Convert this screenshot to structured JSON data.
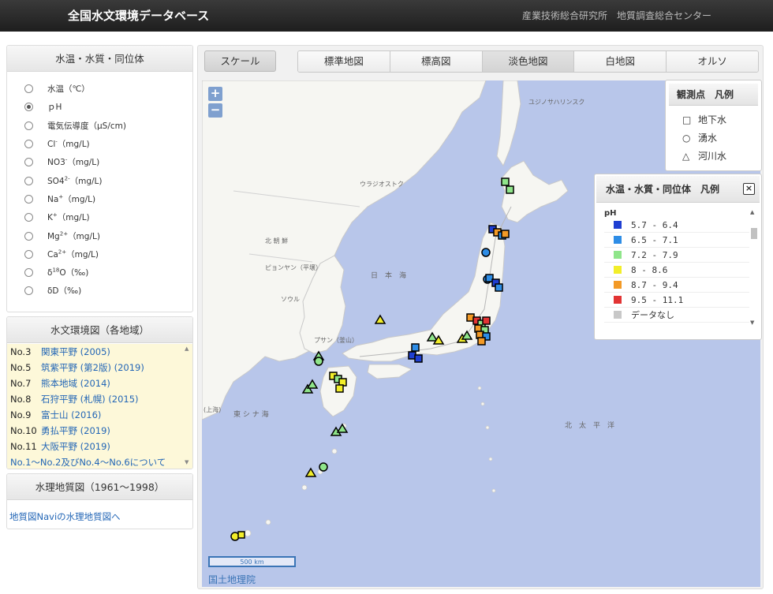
{
  "header": {
    "title": "全国水文環境データベース",
    "org": "産業技術総合研究所　地質調査総合センター"
  },
  "parameters_panel": {
    "title": "水温・水質・同位体",
    "options": [
      {
        "label": "水温（℃）",
        "selected": false
      },
      {
        "label": "ｐH",
        "selected": true
      },
      {
        "label": "電気伝導度（μS/cm)",
        "selected": false
      },
      {
        "label": "Cl",
        "sup": "-",
        "suffix": "（mg/L)",
        "selected": false
      },
      {
        "label": "NO3",
        "sup": "-",
        "suffix": "（mg/L)",
        "selected": false
      },
      {
        "label": "SO4",
        "sup": "2-",
        "suffix": "（mg/L)",
        "selected": false
      },
      {
        "label": "Na",
        "sup": "+",
        "suffix": "（mg/L)",
        "selected": false
      },
      {
        "label": "K",
        "sup": "+",
        "suffix": "（mg/L)",
        "selected": false
      },
      {
        "label": "Mg",
        "sup": "2+",
        "suffix": "（mg/L)",
        "selected": false
      },
      {
        "label": "Ca",
        "sup": "2+",
        "suffix": "（mg/L)",
        "selected": false
      },
      {
        "label": "δ",
        "sup": "18",
        "suffix": "O（‰)",
        "selected": false
      },
      {
        "label": "δD（‰)",
        "selected": false
      }
    ]
  },
  "regions_panel": {
    "title": "水文環境図（各地域）",
    "items": [
      {
        "no": "No.3",
        "name": "関東平野 (2005)"
      },
      {
        "no": "No.5",
        "name": "筑紫平野 (第2版) (2019)"
      },
      {
        "no": "No.7",
        "name": "熊本地域 (2014)"
      },
      {
        "no": "No.8",
        "name": "石狩平野 (札幌) (2015)"
      },
      {
        "no": "No.9",
        "name": "富士山 (2016)"
      },
      {
        "no": "No.10",
        "name": "勇払平野 (2019)"
      },
      {
        "no": "No.11",
        "name": "大阪平野 (2019)"
      }
    ],
    "note": "No.1～No.2及びNo.4～No.6について"
  },
  "hydro_panel": {
    "title": "水理地質図（1961～1998）",
    "link": "地質図Naviの水理地質図へ"
  },
  "toolbar": {
    "scale_label": "スケール",
    "tabs": [
      {
        "label": "標準地図",
        "active": false
      },
      {
        "label": "標高図",
        "active": false
      },
      {
        "label": "淡色地図",
        "active": true
      },
      {
        "label": "白地図",
        "active": false
      },
      {
        "label": "オルソ",
        "active": false
      }
    ]
  },
  "map": {
    "zoom_in": "+",
    "zoom_out": "−",
    "scale_text": "500 km",
    "credit": "国土地理院",
    "labels": {
      "sakhalin": "ユジノサハリンスク",
      "vladivostok": "ウラジオストク",
      "kita": "北 朝 鮮",
      "pyongyang": "ピョンヤン（平壌）",
      "nihonkai": "日　本　海",
      "seoul": "ソウル",
      "busan": "プサン（釜山）",
      "higashi": "東 シ ナ 海",
      "taiheiyo": "北　太　平　洋",
      "kaijou": "(上海)"
    }
  },
  "legend_points": {
    "title": "観測点　凡例",
    "items": [
      {
        "symbol": "□",
        "label": "地下水"
      },
      {
        "symbol": "○",
        "label": "湧水"
      },
      {
        "symbol": "△",
        "label": "河川水"
      }
    ]
  },
  "legend_values": {
    "title": "水温・水質・同位体　凡例",
    "close_icon": "×",
    "subtitle": "pH",
    "classes": [
      {
        "label": "5.7  -  6.4",
        "color": "#1f3fd2"
      },
      {
        "label": "6.5  -  7.1",
        "color": "#2e8de6"
      },
      {
        "label": "7.2  -  7.9",
        "color": "#8fe58a"
      },
      {
        "label": "8  -  8.6",
        "color": "#f2ee2a"
      },
      {
        "label": "8.7  -  9.4",
        "color": "#f39a26"
      },
      {
        "label": "9.5  -  11.1",
        "color": "#e23434"
      },
      {
        "label": "データなし",
        "color": "#c8c8c8"
      }
    ]
  }
}
